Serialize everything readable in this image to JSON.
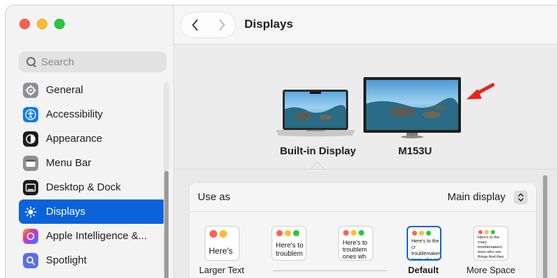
{
  "window": {
    "title": "Displays"
  },
  "sidebar": {
    "search_placeholder": "Search",
    "items": [
      {
        "label": "General",
        "icon": "gear-icon"
      },
      {
        "label": "Accessibility",
        "icon": "accessibility-icon"
      },
      {
        "label": "Appearance",
        "icon": "appearance-icon"
      },
      {
        "label": "Menu Bar",
        "icon": "menubar-icon"
      },
      {
        "label": "Desktop & Dock",
        "icon": "dock-icon"
      },
      {
        "label": "Displays",
        "icon": "sun-icon"
      },
      {
        "label": "Apple Intelligence &...",
        "icon": "apple-intelligence-icon"
      },
      {
        "label": "Spotlight",
        "icon": "spotlight-icon"
      }
    ],
    "active": "Displays"
  },
  "displays": [
    {
      "label": "Built-in Display"
    },
    {
      "label": "M153U"
    }
  ],
  "use_as": {
    "label": "Use as",
    "value": "Main display"
  },
  "resolution_options": [
    {
      "label": "Larger Text",
      "sample": "Here's"
    },
    {
      "label": "",
      "sample": "Here's to troublem"
    },
    {
      "label": "",
      "sample": "Here's to troublem ones wh"
    },
    {
      "label": "Default",
      "sample": "Here's to the cr troublemakers. ones who see t"
    },
    {
      "label": "More Space",
      "sample": "Here's to the crazy troublemakers. ones who see things And they have no can quote them, about the only"
    }
  ],
  "colors": {
    "accent": "#0a63db",
    "annotation_arrow": "#e8231d"
  }
}
